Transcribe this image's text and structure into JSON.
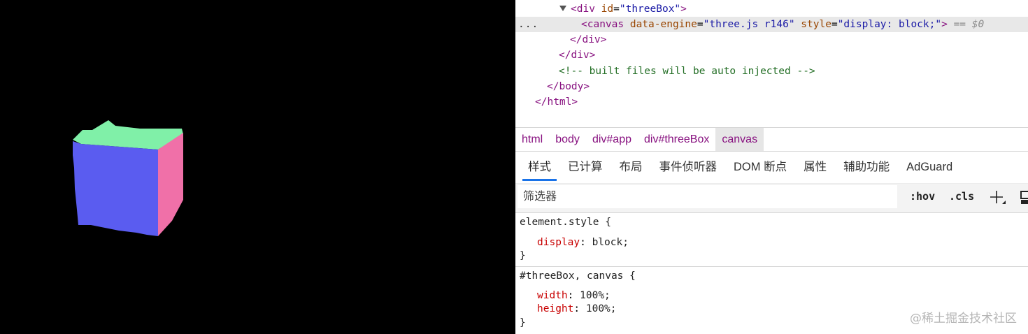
{
  "canvas": {
    "background": "#000000",
    "cube_colors": {
      "front": "#5a5cf0",
      "top": "#80f0a8",
      "side": "#f070a8"
    }
  },
  "elements_panel": {
    "lines": [
      {
        "open": "<div",
        "attr": "id",
        "value": "\"threeBox\"",
        "close": ">"
      },
      {
        "open": "<canvas",
        "attr1": "data-engine",
        "value1": "\"three.js r146\"",
        "attr2": "style",
        "value2": "\"display: block;\"",
        "close": ">",
        "eqs": "== $0",
        "ellipsis": "..."
      },
      {
        "text": "</div>"
      },
      {
        "text": "</div>"
      },
      {
        "comment": "<!-- built files will be auto injected -->"
      },
      {
        "text": "</body>"
      },
      {
        "text": "</html>"
      }
    ]
  },
  "breadcrumb": [
    "html",
    "body",
    "div#app",
    "div#threeBox",
    "canvas"
  ],
  "tabs": [
    "样式",
    "已计算",
    "布局",
    "事件侦听器",
    "DOM 断点",
    "属性",
    "辅助功能",
    "AdGuard"
  ],
  "filter": {
    "placeholder": "筛选器",
    "hov": ":hov",
    "cls": ".cls"
  },
  "rules": [
    {
      "selector": "element.style {",
      "props": [
        {
          "name": "display",
          "value": "block;"
        }
      ],
      "close": "}"
    },
    {
      "selector": "#threeBox, canvas {",
      "props": [
        {
          "name": "width",
          "value": "100%;"
        },
        {
          "name": "height",
          "value": "100%;"
        }
      ],
      "close": "}"
    }
  ],
  "watermark": "@稀土掘金技术社区"
}
